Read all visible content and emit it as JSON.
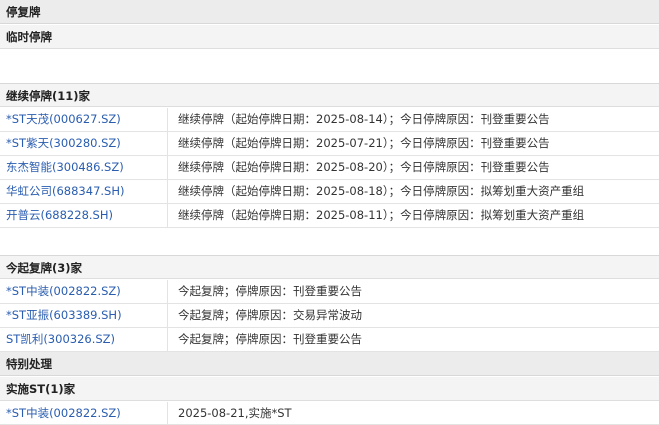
{
  "title": "停复牌",
  "temp_halt": {
    "label": "临时停牌"
  },
  "continued_halt": {
    "label": "继续停牌(11)家",
    "rows": [
      {
        "name": "*ST天茂(000627.SZ)",
        "desc": "继续停牌（起始停牌日期：2025-08-14）；今日停牌原因：刊登重要公告"
      },
      {
        "name": "*ST紫天(300280.SZ)",
        "desc": "继续停牌（起始停牌日期：2025-07-21）；今日停牌原因：刊登重要公告"
      },
      {
        "name": "东杰智能(300486.SZ)",
        "desc": "继续停牌（起始停牌日期：2025-08-20）；今日停牌原因：刊登重要公告"
      },
      {
        "name": "华虹公司(688347.SH)",
        "desc": "继续停牌（起始停牌日期：2025-08-18）；今日停牌原因：拟筹划重大资产重组"
      },
      {
        "name": "开普云(688228.SH)",
        "desc": "继续停牌（起始停牌日期：2025-08-11）；今日停牌原因：拟筹划重大资产重组"
      }
    ]
  },
  "resume": {
    "label": "今起复牌(3)家",
    "rows": [
      {
        "name": "*ST中装(002822.SZ)",
        "desc": "今起复牌；停牌原因：刊登重要公告"
      },
      {
        "name": "*ST亚振(603389.SH)",
        "desc": "今起复牌；停牌原因：交易异常波动"
      },
      {
        "name": "ST凯利(300326.SZ)",
        "desc": "今起复牌；停牌原因：刊登重要公告"
      }
    ]
  },
  "special": {
    "label": "特别处理"
  },
  "st_impl": {
    "label": "实施ST(1)家",
    "rows": [
      {
        "name": "*ST中装(002822.SZ)",
        "desc": "2025-08-21,实施*ST"
      }
    ]
  }
}
